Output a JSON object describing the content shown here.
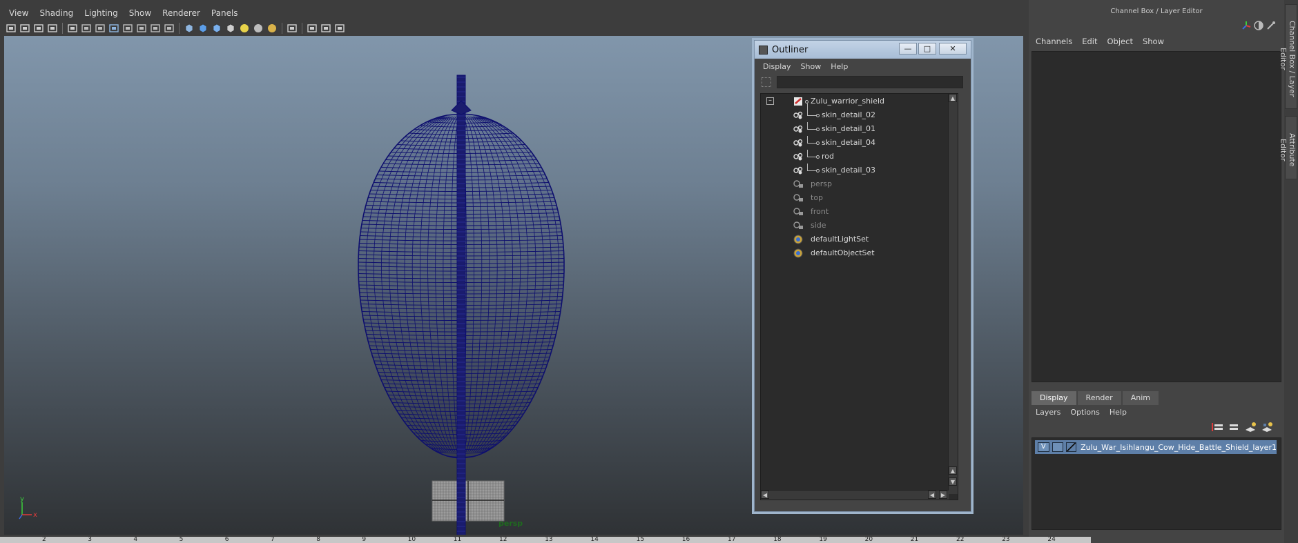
{
  "panel_menu": [
    "View",
    "Shading",
    "Lighting",
    "Show",
    "Renderer",
    "Panels"
  ],
  "toolbar_icons": [
    "camera-icon",
    "camera-attr-icon",
    "bookmark-icon",
    "image-plane-icon",
    "2d-pan-icon",
    "grid-icon",
    "film-gate-icon",
    "resolution-gate-icon",
    "gate-mask-icon",
    "field-chart-icon",
    "safe-action-icon",
    "safe-title-icon",
    "wireframe-icon",
    "smooth-shade-icon",
    "shade-wire-icon",
    "textured-icon",
    "use-all-lights-icon",
    "shadows-icon",
    "high-quality-icon",
    "isolate-select-icon",
    "xray-icon",
    "xray-active-icon",
    "xray-joints-icon"
  ],
  "viewport": {
    "camera_label": "persp",
    "axis_x": "x",
    "axis_y": "y",
    "wire_color": "#0e0f6e"
  },
  "timeline_ticks": [
    "2",
    "3",
    "4",
    "5",
    "6",
    "7",
    "8",
    "9",
    "10",
    "11",
    "12",
    "13",
    "14",
    "15",
    "16",
    "17",
    "18",
    "19",
    "20",
    "21",
    "22",
    "23",
    "24"
  ],
  "outliner": {
    "title": "Outliner",
    "menu": [
      "Display",
      "Show",
      "Help"
    ],
    "search_value": "",
    "items": [
      {
        "label": "Zulu_warrior_shield",
        "icon": "group-icon",
        "indent": 0,
        "dim": false
      },
      {
        "label": "skin_detail_02",
        "icon": "mesh-icon",
        "indent": 1,
        "dim": false
      },
      {
        "label": "skin_detail_01",
        "icon": "mesh-icon",
        "indent": 1,
        "dim": false
      },
      {
        "label": "skin_detail_04",
        "icon": "mesh-icon",
        "indent": 1,
        "dim": false
      },
      {
        "label": "rod",
        "icon": "mesh-icon",
        "indent": 1,
        "dim": false
      },
      {
        "label": "skin_detail_03",
        "icon": "mesh-icon",
        "indent": 1,
        "dim": false
      },
      {
        "label": "persp",
        "icon": "camera-icon",
        "indent": 0,
        "dim": true
      },
      {
        "label": "top",
        "icon": "camera-icon",
        "indent": 0,
        "dim": true
      },
      {
        "label": "front",
        "icon": "camera-icon",
        "indent": 0,
        "dim": true
      },
      {
        "label": "side",
        "icon": "camera-icon",
        "indent": 0,
        "dim": true
      },
      {
        "label": "defaultLightSet",
        "icon": "set-icon",
        "indent": 0,
        "dim": false
      },
      {
        "label": "defaultObjectSet",
        "icon": "set-icon",
        "indent": 0,
        "dim": false
      }
    ]
  },
  "channel_box": {
    "title": "Channel Box / Layer Editor",
    "menu": [
      "Channels",
      "Edit",
      "Object",
      "Show"
    ]
  },
  "layer_editor": {
    "tabs": [
      "Display",
      "Render",
      "Anim"
    ],
    "active_tab": "Display",
    "menu": [
      "Layers",
      "Options",
      "Help"
    ],
    "layers": [
      {
        "visible": "V",
        "name": "Zulu_War_Isihlangu_Cow_Hide_Battle_Shield_layer1"
      }
    ]
  },
  "side_tabs": [
    "Channel Box / Layer Editor",
    "Attribute Editor"
  ],
  "colors": {
    "layer_selected": "#5e7fa8",
    "outliner_frame": "#9fb5cc"
  }
}
